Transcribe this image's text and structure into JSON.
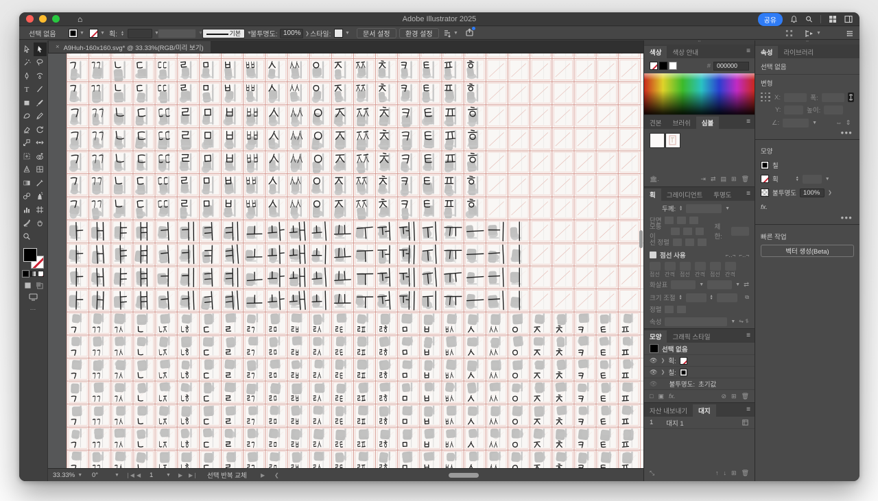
{
  "window": {
    "title": "Adobe Illustrator 2025"
  },
  "titlebar": {
    "share_label": "공유"
  },
  "controlbar": {
    "selection_label": "선택 없음",
    "stroke_label": "획:",
    "line_style_value": "기본",
    "opacity_label": "불투명도:",
    "opacity_value": "100%",
    "style_label": "스타일:",
    "document_setup_label": "문서 설정",
    "preferences_label": "환경 설정"
  },
  "tab": {
    "close": "×",
    "title": "A9Huh-160x160.svg* @ 33.33%(RGB/미리 보기)"
  },
  "toolbar": {
    "tools": [
      "direct-selection",
      "selection",
      "magic-wand",
      "lasso",
      "pen",
      "curvature",
      "type",
      "line-segment",
      "rectangle",
      "paintbrush",
      "shaper",
      "pencil",
      "eraser",
      "rotate",
      "scale",
      "width",
      "free-transform",
      "shape-builder",
      "perspective-grid",
      "mesh",
      "gradient",
      "eyedropper",
      "blend",
      "symbol-sprayer",
      "column-graph",
      "artboard",
      "slice",
      "hand",
      "zoom"
    ]
  },
  "canvas": {
    "grid": {
      "cols": 26,
      "bands": [
        {
          "name": "initial-consonants",
          "rows": 7,
          "jamo": [
            "ㄱ",
            "ㄲ",
            "ㄴ",
            "ㄷ",
            "ㄸ",
            "ㄹ",
            "ㅁ",
            "ㅂ",
            "ㅃ",
            "ㅅ",
            "ㅆ",
            "ㅇ",
            "ㅈ",
            "ㅉ",
            "ㅊ",
            "ㅋ",
            "ㅌ",
            "ㅍ",
            "ㅎ"
          ]
        },
        {
          "name": "medial-vowels",
          "rows": 4,
          "jamo": [
            "ㅏ",
            "ㅐ",
            "ㅑ",
            "ㅒ",
            "ㅓ",
            "ㅔ",
            "ㅕ",
            "ㅖ",
            "ㅗ",
            "ㅘ",
            "ㅙ",
            "ㅚ",
            "ㅛ",
            "ㅜ",
            "ㅝ",
            "ㅞ",
            "ㅟ",
            "ㅠ",
            "ㅡ",
            "ㅢ",
            "ㅣ"
          ]
        },
        {
          "name": "final-consonants",
          "rows": 7,
          "jamo": [
            "ㄱ",
            "ㄲ",
            "ㄳ",
            "ㄴ",
            "ㄵ",
            "ㄶ",
            "ㄷ",
            "ㄹ",
            "ㄺ",
            "ㄻ",
            "ㄼ",
            "ㄽ",
            "ㄾ",
            "ㄿ",
            "ㅀ",
            "ㅁ",
            "ㅂ",
            "ㅄ",
            "ㅅ",
            "ㅆ",
            "ㅇ",
            "ㅈ",
            "ㅊ",
            "ㅋ",
            "ㅌ",
            "ㅍ"
          ]
        }
      ]
    }
  },
  "color_panel": {
    "tab_color": "색상",
    "tab_guide": "색상 안내",
    "hex_symbol": "#",
    "hex_value": "000000"
  },
  "swatch_panel": {
    "tab_swatches": "견본",
    "tab_brushes": "브러쉬",
    "tab_symbols": "심볼"
  },
  "stroke_panel": {
    "tab_stroke": "획",
    "tab_gradient": "그레이디언트",
    "tab_transparency": "투명도",
    "weight_label": "두께:",
    "cap_label": "단면",
    "corner_label": "모퉁이",
    "limit_label": "제한:",
    "align_label": "선 정렬",
    "dashed_label": "점선 사용",
    "dash_labels": [
      "점선",
      "간격",
      "점선",
      "간격",
      "점선",
      "간격"
    ],
    "arrow_label": "화살표",
    "scale_label": "크기 조절",
    "align2_label": "정렬",
    "profile_label": "속성"
  },
  "appearance_panel": {
    "tab_appearance": "모양",
    "tab_styles": "그래픽 스타일",
    "no_selection": "선택 없음",
    "stroke_label": "획:",
    "fill_label": "칠:",
    "opacity_label": "불투명도:",
    "opacity_value": "초기값",
    "fx_label": "fx."
  },
  "artboard_panel": {
    "tab_assets": "자산 내보내기",
    "tab_artboards": "대지",
    "row_number": "1",
    "row_name": "대지 1"
  },
  "properties_panel": {
    "tab_properties": "속성",
    "tab_libraries": "라이브러리",
    "no_selection": "선택 없음",
    "transform_label": "변형",
    "x_label": "X:",
    "y_label": "Y:",
    "w_label": "폭:",
    "h_label": "높이:",
    "angle_label": "∠:",
    "appearance_label": "모양",
    "fill_label": "칠",
    "stroke_label": "획",
    "opacity_label": "불투명도",
    "opacity_value": "100%",
    "fx_label": "fx.",
    "quick_actions_label": "빠른 작업",
    "vector_button": "벡터 생성(Beta)"
  },
  "statusbar": {
    "zoom": "33.33%",
    "rotation": "0°",
    "artboard_nav_value": "1",
    "status_text": "선택 반복 교체"
  }
}
